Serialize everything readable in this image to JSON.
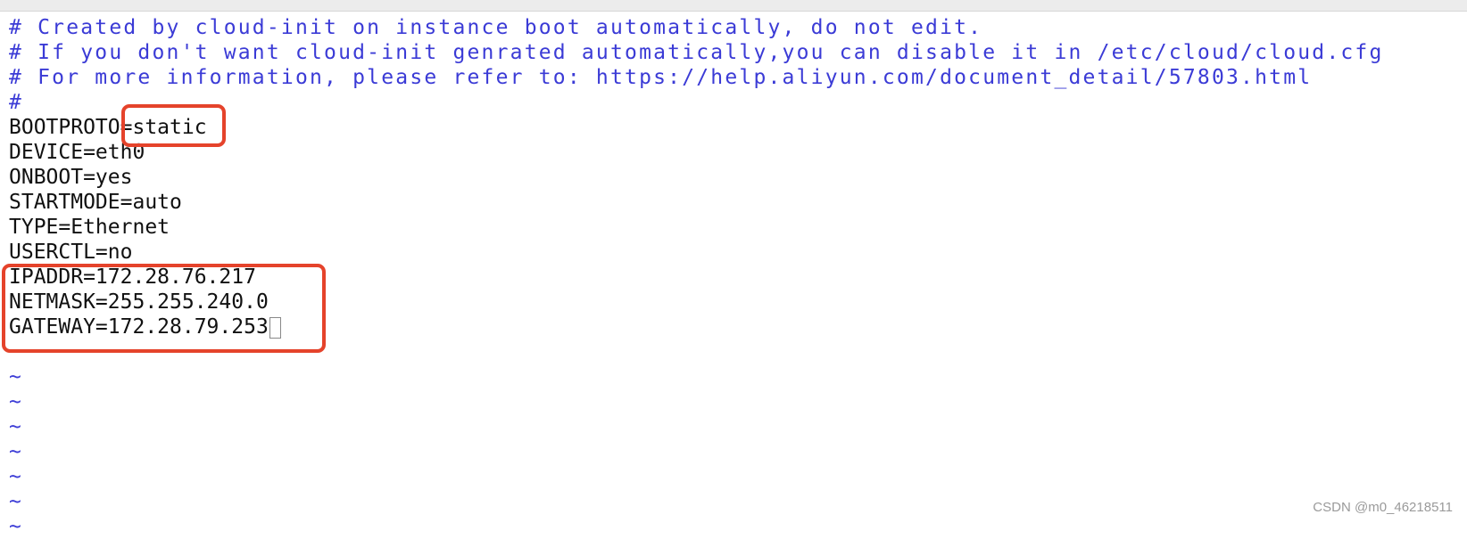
{
  "editor": {
    "lines": [
      {
        "text": "# Created by cloud-init on instance boot automatically, do not edit.",
        "type": "comment"
      },
      {
        "text": "# If you don't want cloud-init genrated automatically,you can disable it in /etc/cloud/cloud.cfg",
        "type": "comment"
      },
      {
        "text": "# For more information, please refer to: https://help.aliyun.com/document_detail/57803.html",
        "type": "comment"
      },
      {
        "text": "#",
        "type": "comment"
      },
      {
        "text": "BOOTPROTO=static",
        "type": "config"
      },
      {
        "text": "DEVICE=eth0",
        "type": "config"
      },
      {
        "text": "ONBOOT=yes",
        "type": "config"
      },
      {
        "text": "STARTMODE=auto",
        "type": "config"
      },
      {
        "text": "TYPE=Ethernet",
        "type": "config"
      },
      {
        "text": "USERCTL=no",
        "type": "config"
      },
      {
        "text": "IPADDR=172.28.76.217",
        "type": "config"
      },
      {
        "text": "NETMASK=255.255.240.0",
        "type": "config"
      },
      {
        "text": "GATEWAY=172.28.79.253",
        "type": "config"
      },
      {
        "text": "",
        "type": "empty"
      }
    ],
    "tilde": "~",
    "tilde_count": 7
  },
  "highlight_color": "#e5432b",
  "comment_color": "#3b3bd6",
  "watermark": "CSDN @m0_46218511"
}
